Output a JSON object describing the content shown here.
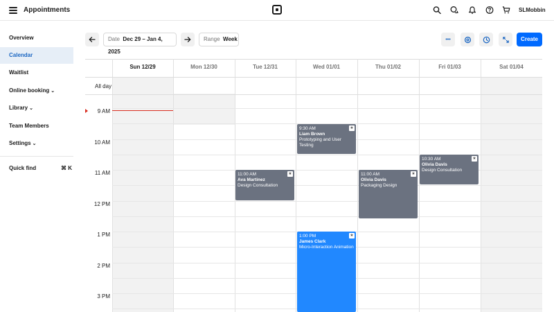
{
  "app": {
    "title": "Appointments",
    "user": "SLMobbin"
  },
  "icons": {
    "menu": "hamburger-icon",
    "logo": "square-logo-icon",
    "search": "search-icon",
    "messages": "chat-icon",
    "notifications": "bell-icon",
    "help": "help-icon",
    "cart": "cart-icon"
  },
  "sidebar": {
    "items": [
      {
        "label": "Overview",
        "active": false,
        "has_chevron": false
      },
      {
        "label": "Calendar",
        "active": true,
        "has_chevron": false
      },
      {
        "label": "Waitlist",
        "active": false,
        "has_chevron": false
      },
      {
        "label": "Online booking",
        "active": false,
        "has_chevron": true
      },
      {
        "label": "Library",
        "active": false,
        "has_chevron": true
      },
      {
        "label": "Team Members",
        "active": false,
        "has_chevron": false
      },
      {
        "label": "Settings",
        "active": false,
        "has_chevron": true
      }
    ],
    "quick_find": "Quick find",
    "shortcut": "⌘ K"
  },
  "toolbar": {
    "date_label": "Date",
    "date_value": "Dec 29 – Jan 4, 2025",
    "range_label": "Range",
    "range_value": "Week",
    "more": "•••",
    "create": "Create"
  },
  "calendar": {
    "days": [
      {
        "label": "Sun 12/29",
        "today": true,
        "weekend": true
      },
      {
        "label": "Mon 12/30",
        "today": false,
        "weekend": false
      },
      {
        "label": "Tue 12/31",
        "today": false,
        "weekend": false
      },
      {
        "label": "Wed 01/01",
        "today": false,
        "weekend": false
      },
      {
        "label": "Thu 01/02",
        "today": false,
        "weekend": false
      },
      {
        "label": "Fri 01/03",
        "today": false,
        "weekend": false
      },
      {
        "label": "Sat 01/04",
        "today": false,
        "weekend": true
      }
    ],
    "all_day": "All day",
    "hours": [
      "9 AM",
      "10 AM",
      "11 AM",
      "12 PM",
      "1 PM",
      "2 PM",
      "3 PM"
    ],
    "events": [
      {
        "time": "9:30 AM",
        "name": "Liam Brown",
        "service": "Prototyping and User Testing",
        "day": "Wed 01/01",
        "color": "#6b7280"
      },
      {
        "time": "10:30 AM",
        "name": "Olivia Davis",
        "service": "Design Consultation",
        "day": "Fri 01/03",
        "color": "#6b7280"
      },
      {
        "time": "11:00 AM",
        "name": "Ava Martinez",
        "service": "Design Consultation",
        "day": "Tue 12/31",
        "color": "#6b7280"
      },
      {
        "time": "11:00 AM",
        "name": "Olivia Davis",
        "service": "Packaging Design",
        "day": "Thu 01/02",
        "color": "#6b7280"
      },
      {
        "time": "1:00 PM",
        "name": "James Clark",
        "service": "Micro-Interaction Animation",
        "day": "Wed 01/01",
        "color": "#2188ff"
      }
    ]
  },
  "colors": {
    "accent": "#006aff",
    "now_line": "#d92c20",
    "event_grey": "#6b7280",
    "event_blue": "#2188ff",
    "active_bg": "#e6eef7"
  }
}
